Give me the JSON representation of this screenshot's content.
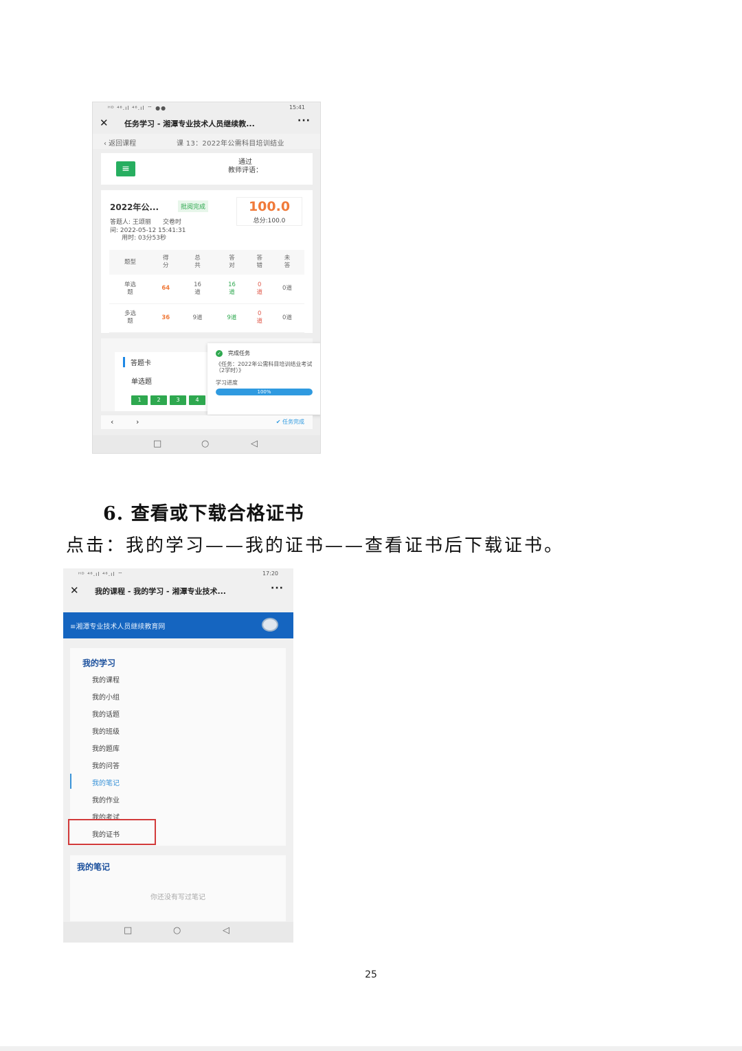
{
  "screenshot1": {
    "status": {
      "left": "ᴴᴰ ⁴⁶.ıl ⁴⁶.ıl ⌔ ●●",
      "time": "15:41"
    },
    "titlebar": {
      "close": "✕",
      "title": "任务学习 - 湘潭专业技术人员继续教...",
      "more": "···"
    },
    "backrow": {
      "back": "‹ 返回课程",
      "course": "课 13：2022年公需科目培训结业"
    },
    "pass_card": {
      "status": "通过",
      "comment_label": "教师评语："
    },
    "exam": {
      "title": "2022年公...",
      "badge": "批阅完成",
      "meta": "答题人: 王颂丽      交卷时\n间: 2022-05-12 15:41:31\n      用时: 03分53秒",
      "score": "100.0",
      "total": "总分:100.0"
    },
    "table": {
      "headers": [
        "题型",
        "得\n分",
        "总\n共",
        "答\n对",
        "答\n错",
        "未\n答"
      ],
      "rows": [
        [
          "单选\n题",
          "64",
          "16\n道",
          "16\n道",
          "0\n道",
          "0道"
        ],
        [
          "多选\n题",
          "36",
          "9道",
          "9道",
          "0\n道",
          "0道"
        ]
      ]
    },
    "answer_card": {
      "label": "答题卡",
      "section": "单选题",
      "buttons": [
        "1",
        "2",
        "3",
        "4"
      ]
    },
    "task_popup": {
      "header": "完成任务",
      "desc": "《任务：2022年公需科目培训结业考试（2学时）》",
      "progress_label": "学习进度",
      "progress_text": "100%",
      "progress_value": 1.0
    },
    "navrow": {
      "prev": "‹",
      "next": "›",
      "done": "✔ 任务完成"
    },
    "sysnav": {
      "square": "□",
      "circle": "○",
      "back": "◁"
    }
  },
  "heading": "6. 查看或下载合格证书",
  "instruction": "点击：我的学习——我的证书——查看证书后下载证书。",
  "screenshot2": {
    "status": {
      "left": "ᴴᴰ ⁴⁶.ıl ⁴⁶.ıl ⌔",
      "time": "17:20"
    },
    "titlebar": {
      "close": "✕",
      "title": "我的课程 - 我的学习 - 湘潭专业技术...",
      "more": "···"
    },
    "site_title": "≡湘潭专业技术人员继续教育网",
    "menu": {
      "title": "我的学习",
      "items": [
        "我的课程",
        "我的小组",
        "我的话题",
        "我的班级",
        "我的题库",
        "我的问答",
        "我的笔记",
        "我的作业",
        "我的考试",
        "我的证书"
      ],
      "active_index": 6
    },
    "notes": {
      "title": "我的笔记",
      "empty": "你还没有写过笔记"
    },
    "sysnav": {
      "square": "□",
      "circle": "○",
      "back": "◁"
    }
  },
  "page_number": "25"
}
